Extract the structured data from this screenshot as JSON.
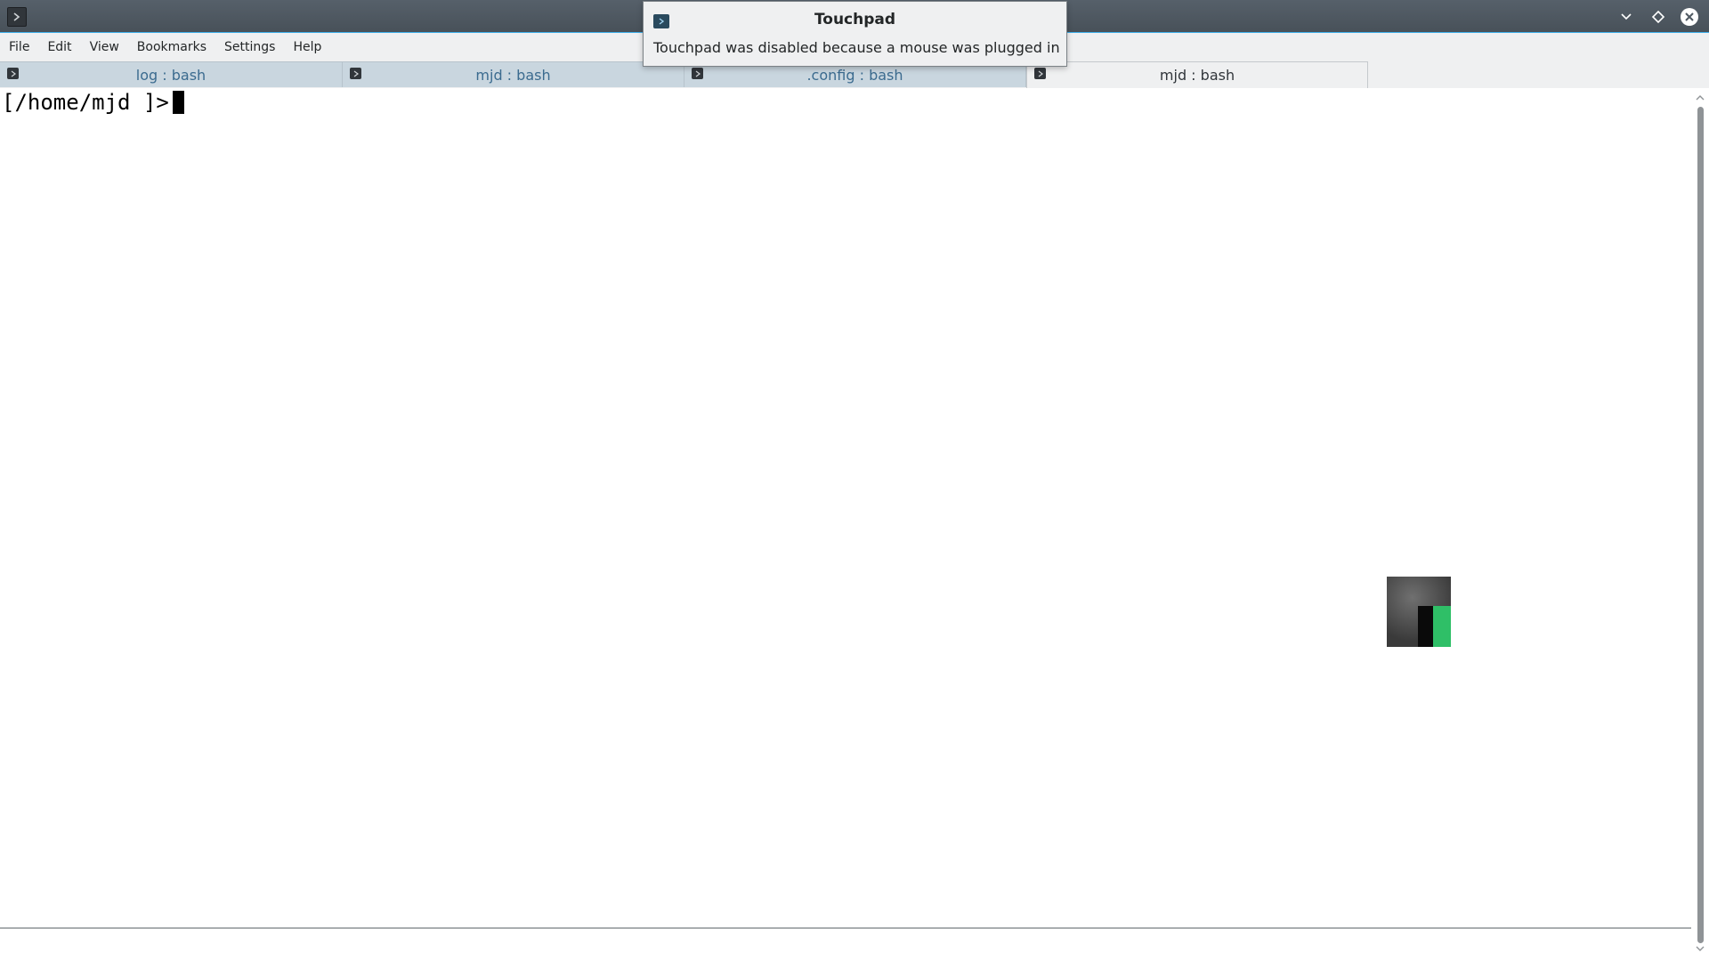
{
  "menubar": {
    "items": [
      "File",
      "Edit",
      "View",
      "Bookmarks",
      "Settings",
      "Help"
    ]
  },
  "tabs": [
    {
      "label": "log : bash",
      "active": false
    },
    {
      "label": "mjd : bash",
      "active": false
    },
    {
      "label": ".config : bash",
      "active": false
    },
    {
      "label": "mjd : bash",
      "active": true
    }
  ],
  "terminal": {
    "prompt": "[/home/mjd ]>"
  },
  "notification": {
    "title": "Touchpad",
    "body": "Touchpad was disabled because a mouse was plugged in",
    "icon": "terminal-icon"
  },
  "window_controls": [
    "minimize-icon",
    "maximize-icon",
    "close-icon"
  ],
  "colors": {
    "titlebar": "#4f5962",
    "accent": "#3daee9",
    "tab_inactive": "#c9d6df",
    "tab_text": "#3b6b8f",
    "thumb_green": "#2fbf67"
  }
}
